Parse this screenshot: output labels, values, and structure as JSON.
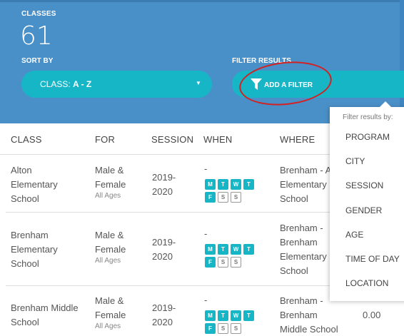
{
  "header": {
    "classes_label": "CLASSES",
    "classes_count": "61",
    "sort_label": "SORT BY",
    "sort_value_prefix": "CLASS:",
    "sort_value": "A - Z",
    "filter_label": "FILTER RESULTS",
    "add_filter": "ADD A FILTER",
    "accent_color": "#17b6c7",
    "header_color": "#4a90c8"
  },
  "table": {
    "columns": [
      "CLASS",
      "FOR",
      "SESSION",
      "WHEN",
      "WHERE"
    ],
    "rows": [
      {
        "class_lines": [
          "Alton",
          "Elementary",
          "School"
        ],
        "for_lines": [
          "Male &",
          "Female"
        ],
        "age": "All Ages",
        "session_lines": [
          "2019-",
          "2020"
        ],
        "when": "-",
        "where_lines": [
          "Brenham - A",
          "Elementary",
          "School"
        ],
        "price": ""
      },
      {
        "class_lines": [
          "Brenham",
          "Elementary",
          "School"
        ],
        "for_lines": [
          "Male &",
          "Female"
        ],
        "age": "All Ages",
        "session_lines": [
          "2019-",
          "2020"
        ],
        "when": "-",
        "where_lines": [
          "Brenham -",
          "Brenham",
          "Elementary",
          "School"
        ],
        "price": ""
      },
      {
        "class_lines": [
          "Brenham Middle",
          "School"
        ],
        "for_lines": [
          "Male &",
          "Female"
        ],
        "age": "All Ages",
        "session_lines": [
          "2019-",
          "2020"
        ],
        "when": "-",
        "where_lines": [
          "Brenham -",
          "Brenham",
          "Middle School"
        ],
        "price": "0.00"
      }
    ],
    "days_row1": [
      "M",
      "T",
      "W",
      "T"
    ],
    "days_row2_on": "F",
    "days_row2_off": [
      "S",
      "S"
    ]
  },
  "filter_menu": {
    "title": "Filter results by:",
    "items": [
      "PROGRAM",
      "CITY",
      "SESSION",
      "GENDER",
      "AGE",
      "TIME OF DAY",
      "LOCATION"
    ]
  }
}
